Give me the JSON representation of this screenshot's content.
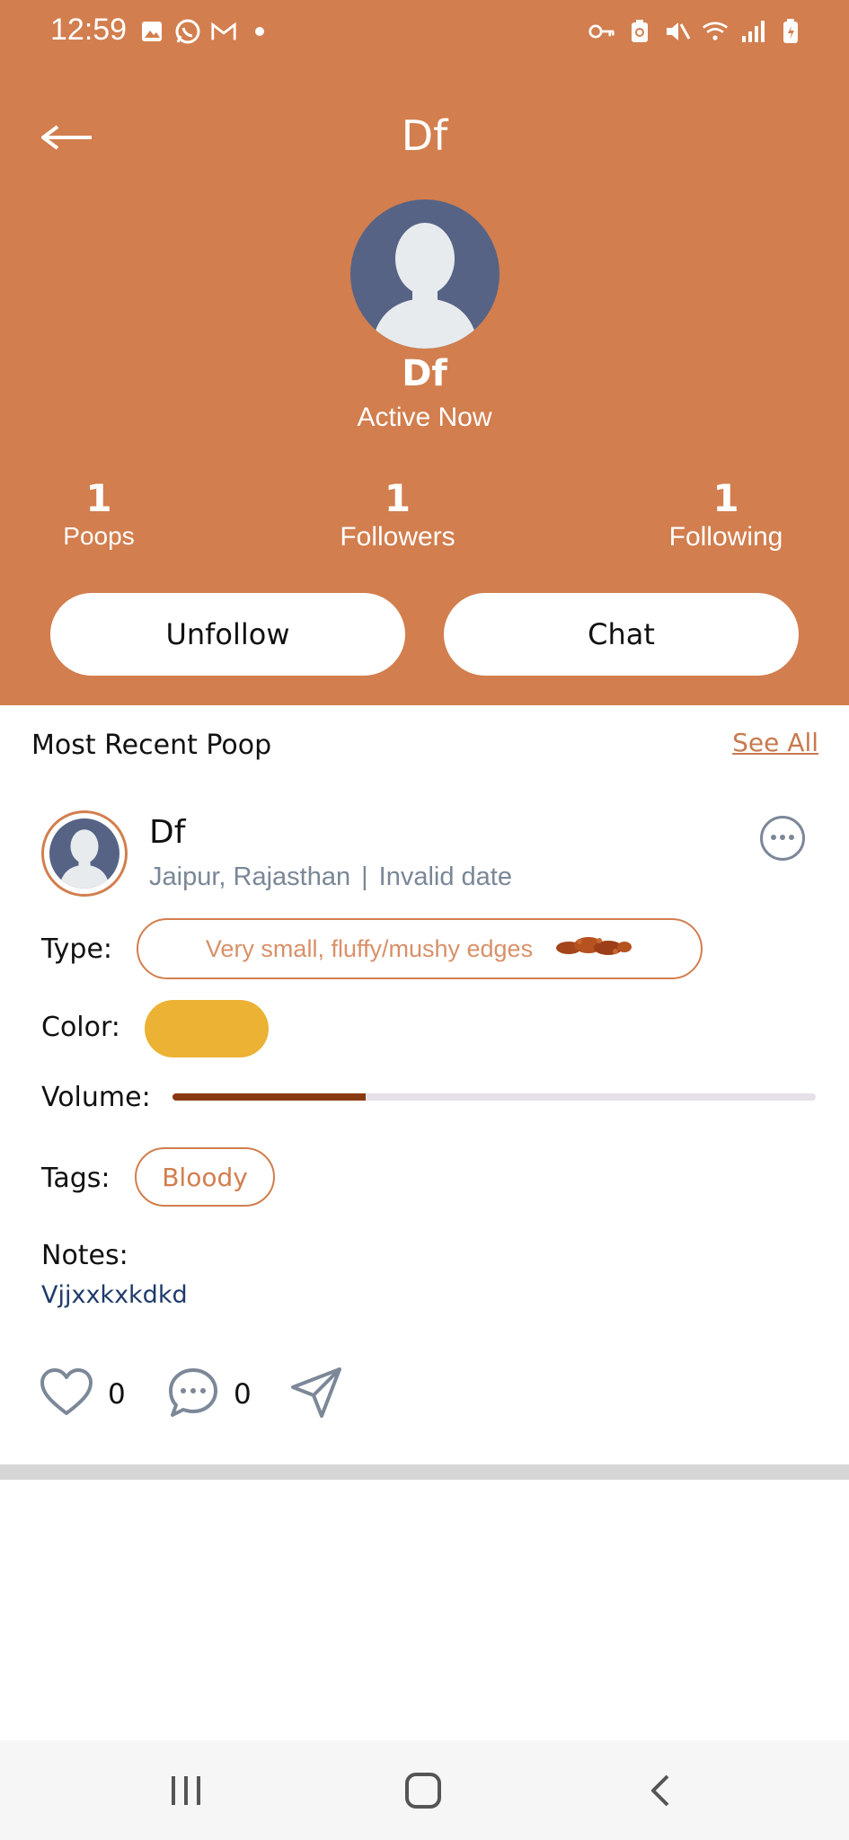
{
  "status_bar": {
    "time": "12:59",
    "left_icons": [
      "gallery-icon",
      "whatsapp-icon",
      "gmail-icon",
      "dot-icon"
    ],
    "right_icons": [
      "key-icon",
      "battery-saver-icon",
      "mute-icon",
      "wifi-icon",
      "signal-icon",
      "battery-icon"
    ]
  },
  "header": {
    "title": "Df",
    "back_icon": "arrow-left-icon"
  },
  "profile": {
    "name": "Df",
    "status": "Active Now",
    "stats": [
      {
        "value": "1",
        "label": "Poops"
      },
      {
        "value": "1",
        "label": "Followers"
      },
      {
        "value": "1",
        "label": "Following"
      }
    ],
    "unfollow_label": "Unfollow",
    "chat_label": "Chat"
  },
  "recent": {
    "section_title": "Most Recent Poop",
    "see_all_label": "See All"
  },
  "post": {
    "user": "Df",
    "location": "Jaipur, Rajasthan",
    "separator": "|",
    "date": "Invalid date",
    "type_label": "Type:",
    "type_value": "Very small, fluffy/mushy edges",
    "color_label": "Color:",
    "color_value": "#ebb233",
    "volume_label": "Volume:",
    "volume_fraction": 0.3,
    "tags_label": "Tags:",
    "tags": [
      "Bloody"
    ],
    "notes_label": "Notes:",
    "notes_value": "Vjjxxkxkdkd",
    "likes": "0",
    "comments": "0"
  },
  "colors": {
    "brand": "#d27e4e",
    "meta_gray": "#7a8797",
    "volume_fill": "#8a3a12"
  },
  "nav": [
    "recents-icon",
    "home-icon",
    "back-icon"
  ]
}
